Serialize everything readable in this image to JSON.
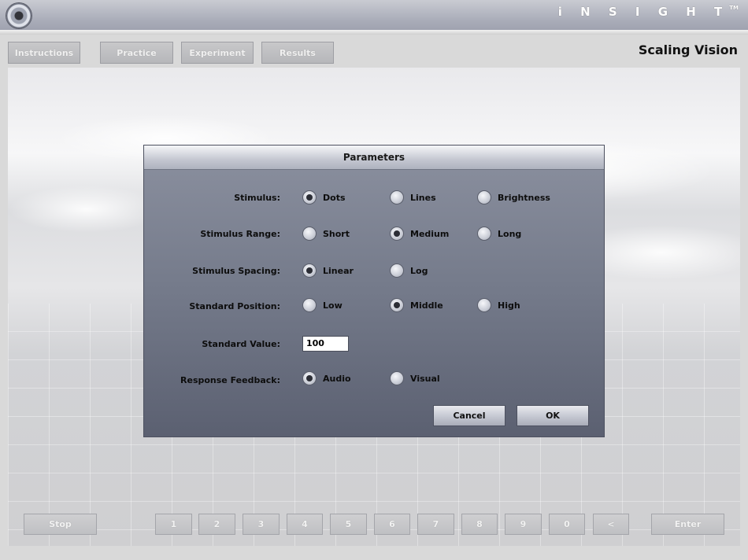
{
  "brand": {
    "name": "i N S I G H T",
    "tm": "TM"
  },
  "nav": {
    "items": [
      {
        "label": "Instructions"
      },
      {
        "label": "Practice"
      },
      {
        "label": "Experiment"
      },
      {
        "label": "Results"
      }
    ]
  },
  "app_title": "Scaling Vision",
  "dialog": {
    "title": "Parameters",
    "rows": [
      {
        "label": "Stimulus:",
        "options": [
          "Dots",
          "Lines",
          "Brightness"
        ],
        "selected": "Dots"
      },
      {
        "label": "Stimulus Range:",
        "options": [
          "Short",
          "Medium",
          "Long"
        ],
        "selected": "Medium"
      },
      {
        "label": "Stimulus Spacing:",
        "options": [
          "Linear",
          "Log"
        ],
        "selected": "Linear"
      },
      {
        "label": "Standard Position:",
        "options": [
          "Low",
          "Middle",
          "High"
        ],
        "selected": "Middle"
      },
      {
        "label": "Standard Value:",
        "input_value": "100"
      },
      {
        "label": "Response Feedback:",
        "options": [
          "Audio",
          "Visual"
        ],
        "selected": "Audio"
      }
    ],
    "cancel_label": "Cancel",
    "ok_label": "OK"
  },
  "keypad": {
    "stop_label": "Stop",
    "keys": [
      "1",
      "2",
      "3",
      "4",
      "5",
      "6",
      "7",
      "8",
      "9",
      "0",
      "<"
    ],
    "enter_label": "Enter"
  },
  "colors": {
    "dialog_top": "#8b909f",
    "dialog_bottom": "#5b6071",
    "selected_dot": "#2b2d35"
  }
}
